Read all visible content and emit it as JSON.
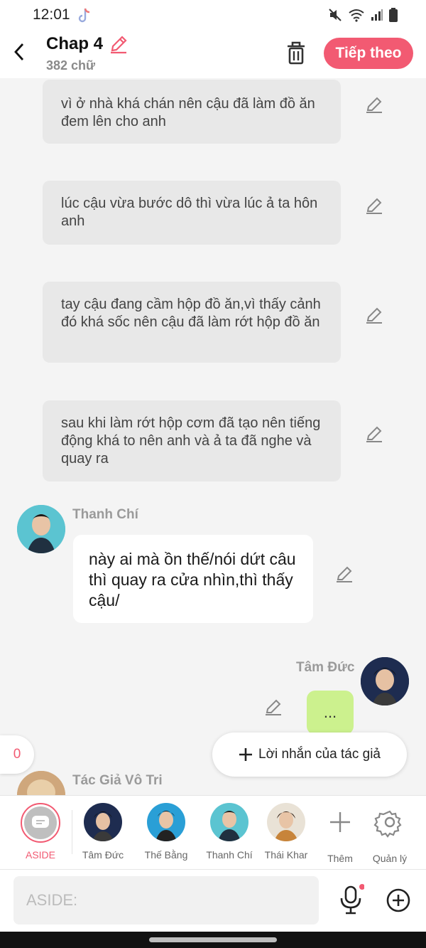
{
  "status_bar": {
    "time": "12:01"
  },
  "header": {
    "title": "Chap 4",
    "word_count": "382 chữ",
    "next_label": "Tiếp theo"
  },
  "narrations": [
    {
      "text": "vì ở nhà khá chán nên cậu đã làm đồ ăn đem lên cho anh"
    },
    {
      "text": "lúc cậu vừa bước dô thì vừa lúc ả ta hôn anh"
    },
    {
      "text": "tay cậu đang cầm hộp đồ ăn,vì thấy cảnh đó khá sốc nên cậu đã làm rớt hộp đồ ăn"
    },
    {
      "text": "sau khi làm rớt hộp cơm đã tạo nên tiếng động khá to nên anh và ả ta đã nghe và quay ra"
    }
  ],
  "messages": [
    {
      "speaker": "Thanh Chí",
      "text": "này ai mà ồn thế/nói dứt câu thì quay ra cửa nhìn,thì thấy cậu/"
    },
    {
      "speaker": "Tâm Đức",
      "text": "..."
    },
    {
      "speaker": "Tác Giả Vô Tri"
    }
  ],
  "comment_count": "0",
  "author_note_label": "Lời nhắn của tác giả",
  "characters": [
    {
      "label": "ASIDE"
    },
    {
      "label": "Tâm Đức"
    },
    {
      "label": "Thế Bằng"
    },
    {
      "label": "Thanh Chí"
    },
    {
      "label": "Thái Khar"
    },
    {
      "label": "Thêm"
    },
    {
      "label": "Quản lý"
    }
  ],
  "input": {
    "placeholder": "ASIDE:"
  },
  "colors": {
    "accent": "#f25a72",
    "bubble_green": "#ccf18e",
    "narration_bg": "#e8e8e8"
  }
}
